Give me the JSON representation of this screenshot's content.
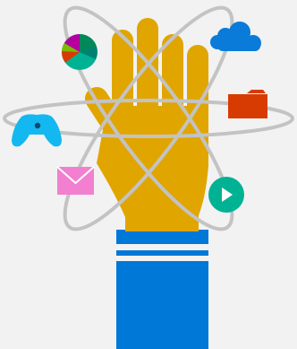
{
  "illustration": {
    "subject": "hand-with-orbiting-app-icons",
    "icons": [
      "pie-chart-icon",
      "cloud-icon",
      "gamepad-icon",
      "folder-icon",
      "mail-icon",
      "play-icon"
    ]
  },
  "colors": {
    "background": "#f2f2f2",
    "hand": "#e1a500",
    "sleeve": "#0078d7",
    "orbit": "#c3c3c3",
    "cloud": "#0a7bd8",
    "folder": "#d83b01",
    "gamepad": "#14b8f0",
    "mail": "#f27fcf",
    "play": "#00b294"
  }
}
